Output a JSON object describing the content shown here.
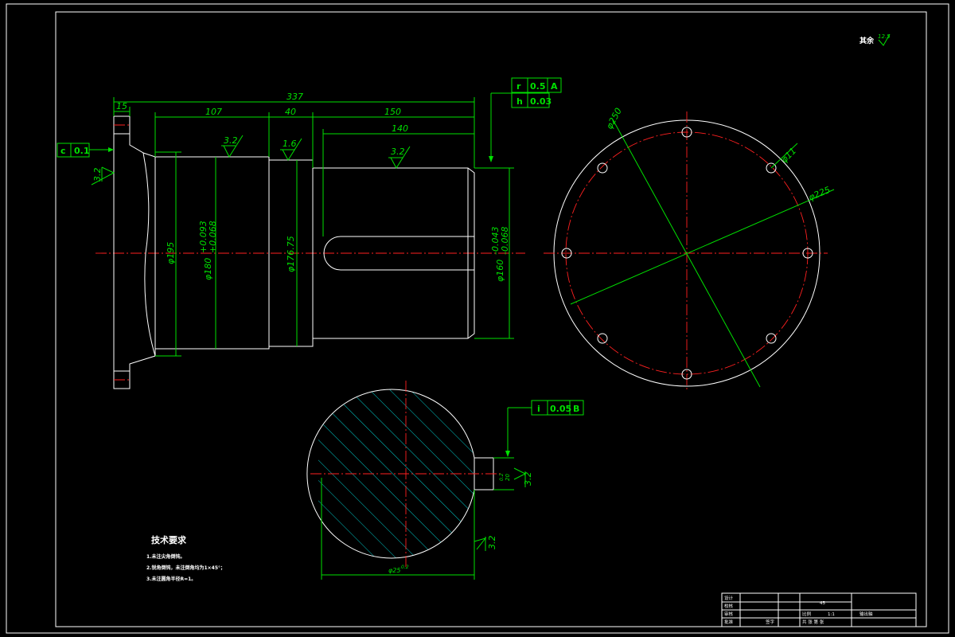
{
  "roughness_note": {
    "label": "其余",
    "value": "12.5"
  },
  "dimensions": {
    "total_length": "337",
    "flange_thk": "15",
    "len_107": "107",
    "len_40": "40",
    "len_150": "150",
    "keyway_len": "140",
    "dia_195": "φ195",
    "dia_180": "φ180",
    "dia_180_tol_upper": "+0.093",
    "dia_180_tol_lower": "+0.068",
    "dia_17675": "φ176.75",
    "dia_160": "φ160",
    "dia_160_tol_upper": "-0.043",
    "dia_160_tol_lower": "-0.068",
    "pcd_250": "φ250",
    "hole_11": "φ11",
    "pcd_225": "φ225",
    "section_dia": "φ25",
    "section_tol": "0.2",
    "key_dim": "20",
    "key_tol": "0.2"
  },
  "roughness": {
    "ra_32_a": "3.2",
    "ra_16": "1.6",
    "ra_32_b": "3.2",
    "ra_32_flange": "3.2",
    "ra_32_key": "3.2",
    "ra_32_bottom": "3.2"
  },
  "tolerance_frames": {
    "top_row1": {
      "sym": "r",
      "val": "0.5",
      "datum": "A"
    },
    "top_row2": {
      "sym": "h",
      "val": "0.03"
    },
    "flange": {
      "sym": "c",
      "val": "0.1"
    },
    "section": {
      "sym": "i",
      "val": "0.05",
      "datum": "B"
    }
  },
  "tech_requirements": {
    "title": "技术要求",
    "items": [
      "1.未注尖角倒钝。",
      "2.锐角倒钝，未注倒角均为1×45°；",
      "3.未注圆角半径R=1。"
    ]
  },
  "title_block": {
    "rows_left": [
      "设计",
      "校核",
      "审核",
      "批准"
    ],
    "stamp": "签字",
    "material": "45",
    "scale_label": "比例",
    "scale_value": "1:1",
    "part_name": "输出轴",
    "sheet_info": "共 张 第 张"
  },
  "colors": {
    "geometry": "#ffffff",
    "dimension": "#00e000",
    "centerline": "#ff2020",
    "hatch": "#00c8c8"
  }
}
